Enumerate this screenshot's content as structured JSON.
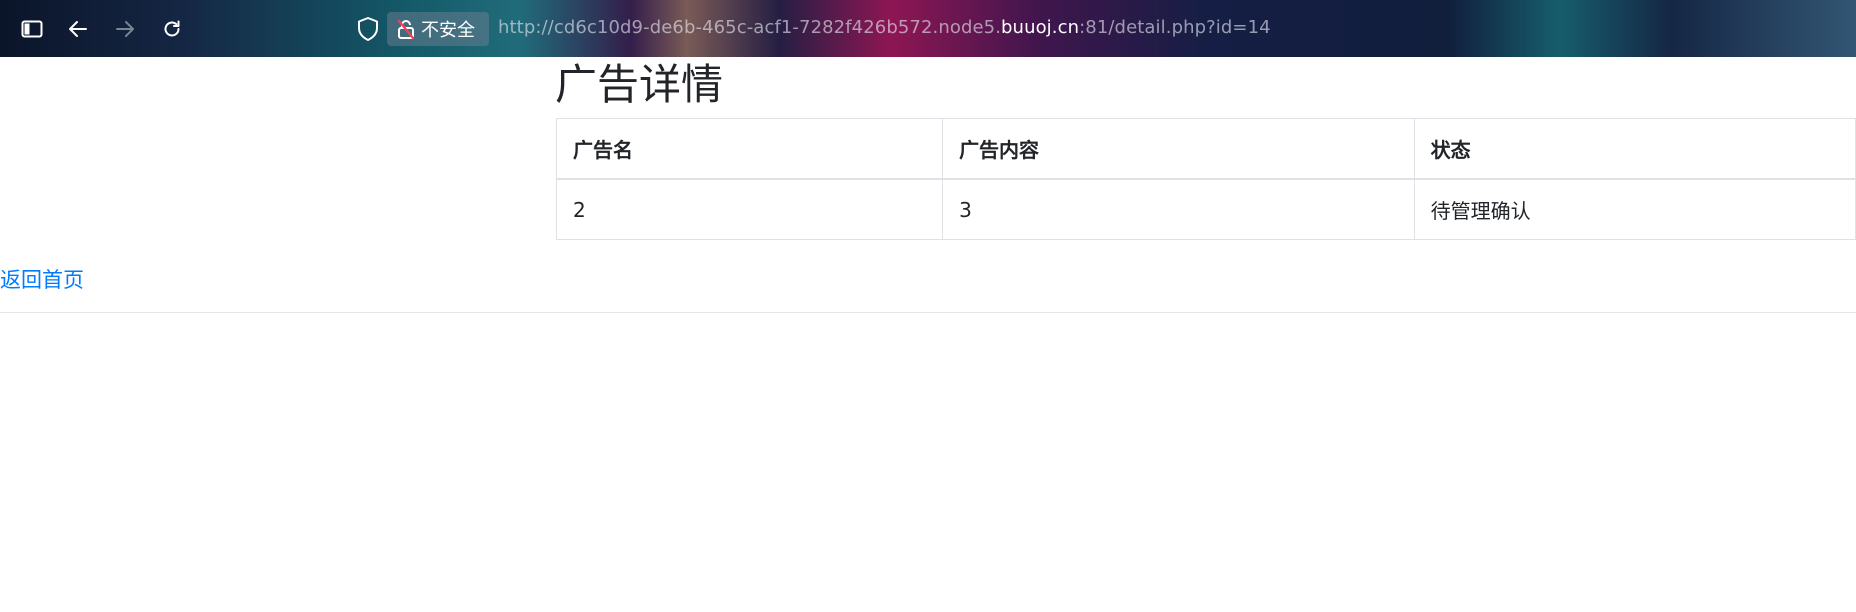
{
  "browser": {
    "security_label": "不安全",
    "url_prefix": "http://cd6c10d9-de6b-465c-acf1-7282f426b572.node5.",
    "url_host": "buuoj.cn",
    "url_suffix": ":81/detail.php?id=14",
    "icons": [
      "sidebar-icon",
      "back-arrow-icon",
      "forward-arrow-icon",
      "reload-icon",
      "shield-icon",
      "insecure-lock-icon"
    ]
  },
  "page": {
    "title": "广告详情",
    "table": {
      "headers": [
        "广告名",
        "广告内容",
        "状态"
      ],
      "rows": [
        [
          "2",
          "3",
          "待管理确认"
        ]
      ]
    },
    "back_link": "返回首页"
  },
  "colors": {
    "link": "#007bff",
    "text": "#212529",
    "border": "#dee2e6"
  }
}
